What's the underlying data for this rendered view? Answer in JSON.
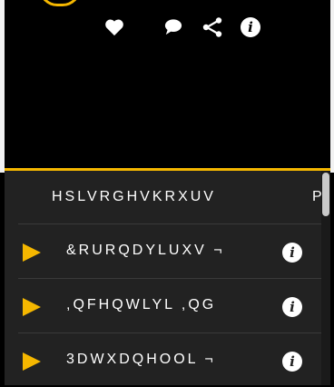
{
  "actions": {
    "like_icon": "heart-icon",
    "comment_icon": "comment-icon",
    "share_icon": "share-icon",
    "info_icon": "info-icon",
    "info_glyph": "i"
  },
  "list": {
    "header_label": "HSLVRGHVKRXUV",
    "header_next": "P",
    "items": [
      {
        "label": "&RURQDYLUXV ¬",
        "info": "i"
      },
      {
        "label": ",QFHQWLYL ,QG",
        "info": "i"
      },
      {
        "label": "3DWXDQHOOL ¬",
        "info": "i"
      }
    ]
  },
  "colors": {
    "accent": "#f5b700",
    "background": "#000000",
    "list_bg": "#222222"
  }
}
